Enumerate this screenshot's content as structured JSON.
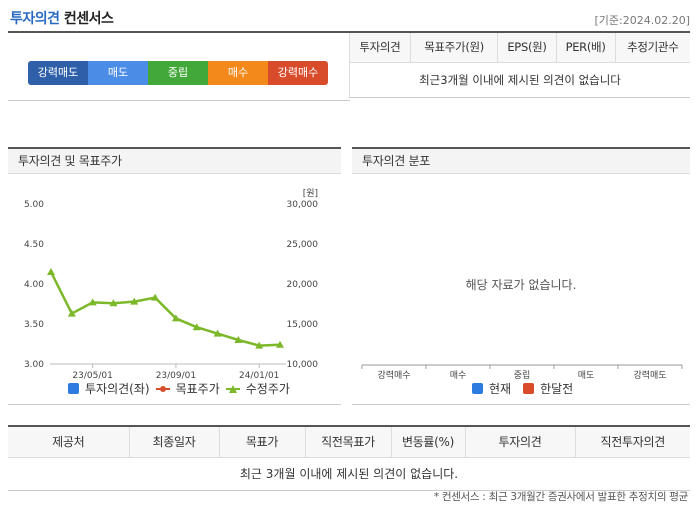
{
  "header": {
    "title_main": "투자의견",
    "title_sub": "컨센서스",
    "date": "[기준:2024.02.20]"
  },
  "scale": {
    "items": [
      {
        "label": "강력매도",
        "color": "#2e5fa8"
      },
      {
        "label": "매도",
        "color": "#4a8ce6"
      },
      {
        "label": "중립",
        "color": "#43a83a"
      },
      {
        "label": "매수",
        "color": "#f3891a"
      },
      {
        "label": "강력매수",
        "color": "#d84c2c"
      }
    ]
  },
  "summary_table": {
    "headers": [
      "투자의견",
      "목표주가(원)",
      "EPS(원)",
      "PER(배)",
      "추정기관수"
    ],
    "empty_message": "최근3개월 이내에 제시된 의견이 없습니다"
  },
  "left_panel": {
    "title": "투자의견 및 목표주가",
    "legend": [
      "투자의견(좌)",
      "목표주가",
      "수정주가"
    ],
    "legend_colors": [
      "#2d7be0",
      "#d84c2c",
      "#7cb829"
    ]
  },
  "right_panel": {
    "title": "투자의견 분포",
    "no_data": "해당 자료가 없습니다.",
    "categories": [
      "강력매수",
      "매수",
      "중립",
      "매도",
      "강력매도"
    ],
    "legend": [
      "현재",
      "한달전"
    ],
    "legend_colors": [
      "#2d7be0",
      "#d84c2c"
    ]
  },
  "bottom_table": {
    "headers": [
      "제공처",
      "최종일자",
      "목표가",
      "직전목표가",
      "변동률(%)",
      "투자의견",
      "직전투자의견"
    ],
    "empty_message": "최근 3개월 이내에 제시된 의견이 없습니다."
  },
  "footnote": "* 컨센서스 : 최근 3개월간 증권사에서 발표한 추정치의 평균",
  "chart_data": {
    "type": "line",
    "left_axis": {
      "ticks": [
        "5.00",
        "4.50",
        "4.00",
        "3.50",
        "3.00"
      ],
      "range": [
        3.0,
        5.0
      ]
    },
    "right_axis": {
      "unit": "[원]",
      "ticks": [
        "30,000",
        "25,000",
        "20,000",
        "15,000",
        "10,000"
      ],
      "range": [
        10000,
        30000
      ]
    },
    "x_ticks": [
      "23/05/01",
      "23/09/01",
      "24/01/01"
    ],
    "series": [
      {
        "name": "수정주가",
        "axis": "right",
        "color": "#7cb829",
        "x": [
          "2023-03",
          "2023-04",
          "2023-05",
          "2023-06",
          "2023-07",
          "2023-08",
          "2023-09",
          "2023-10",
          "2023-11",
          "2023-12",
          "2024-01",
          "2024-02"
        ],
        "values": [
          21500,
          16300,
          17700,
          17600,
          17800,
          18300,
          15700,
          14600,
          13800,
          13000,
          12300,
          12400
        ]
      }
    ]
  }
}
